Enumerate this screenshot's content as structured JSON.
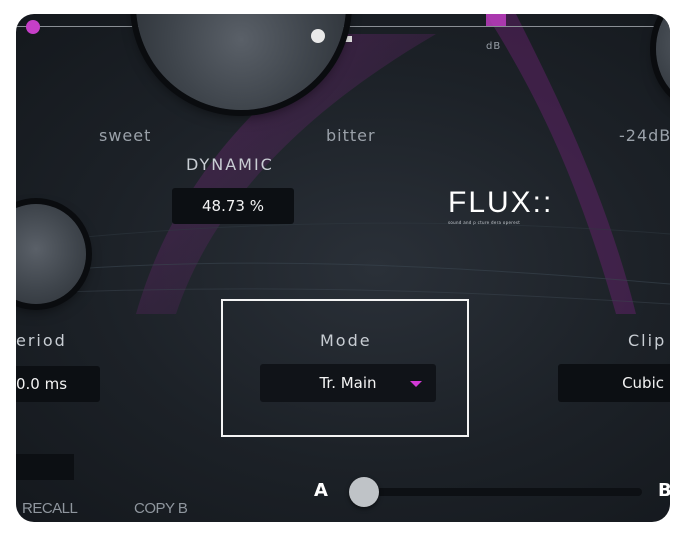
{
  "knobs": {
    "dynamic": {
      "left_label": "sweet",
      "right_label": "bitter",
      "title": "DYNAMIC",
      "value": "48.73 %"
    },
    "right_partial": {
      "left_label": "-24dB",
      "scale_label": "dB"
    },
    "period": {
      "title": "eriod",
      "value": "0.0 ms"
    },
    "clip": {
      "title": "Clip",
      "value": "Cubic"
    }
  },
  "mode": {
    "title": "Mode",
    "selected": "Tr. Main"
  },
  "brand": {
    "logo": "FLUX::",
    "tagline": "sound and p cture dera operest"
  },
  "bottom": {
    "recall_label": "RECALL",
    "copy_label": "COPY B",
    "a_label": "A",
    "b_label": "B",
    "ab_position": 0.0
  },
  "colors": {
    "accent": "#d23ad6",
    "panel_bg": "#1c2127",
    "highlight_border": "#f4f4f4"
  },
  "icons": [
    "knob",
    "dropdown-caret-icon",
    "slider-thumb"
  ]
}
